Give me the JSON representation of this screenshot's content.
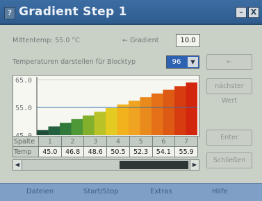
{
  "window": {
    "title": "Gradient Step 1",
    "help_symbol": "?",
    "minimize_symbol": "–",
    "close_symbol": "X"
  },
  "controls": {
    "mittentemp_label": "Mittentemp: 55.0 °C",
    "gradient_label": "← Gradient",
    "gradient_value": "10.0",
    "blocktyp_label": "Temperaturen darstellen für Blocktyp",
    "blocktyp_value": "96",
    "dropdown_arrow": "▼"
  },
  "side_buttons": {
    "back": "←",
    "next_value": "nächster Wert",
    "enter": "Enter",
    "close": "Schließen"
  },
  "chart_data": {
    "type": "bar",
    "values": [
      45.0,
      45.0,
      46.8,
      46.8,
      48.6,
      48.6,
      50.5,
      50.5,
      52.3,
      52.3,
      54.1,
      54.1,
      55.9,
      55.9
    ],
    "colors": [
      "#1e4e35",
      "#256040",
      "#327a3c",
      "#4e9838",
      "#82b02c",
      "#b9c227",
      "#e3cb22",
      "#f2b21c",
      "#efa320",
      "#e98a1c",
      "#e57018",
      "#dd5a14",
      "#d63c10",
      "#d2270e"
    ],
    "ytick_labels": [
      "65.0",
      "55.0",
      "45.0"
    ],
    "ylim": [
      45.0,
      65.0
    ],
    "reference_line": 55.0,
    "grid": true,
    "accent_line_color": "#3a6ea8"
  },
  "table": {
    "header_label": "Spalte",
    "headers": [
      "1",
      "2",
      "3",
      "4",
      "5",
      "6",
      "7"
    ],
    "value_label": "Temp",
    "values": [
      "45.0",
      "46.8",
      "48.6",
      "50.5",
      "52.3",
      "54.1",
      "55.9"
    ]
  },
  "scrollbar": {
    "left_arrow": "◀",
    "right_arrow": "▶"
  },
  "menu": {
    "items": [
      "Dateien",
      "Start/Stop",
      "Extras",
      "Hilfe"
    ]
  }
}
